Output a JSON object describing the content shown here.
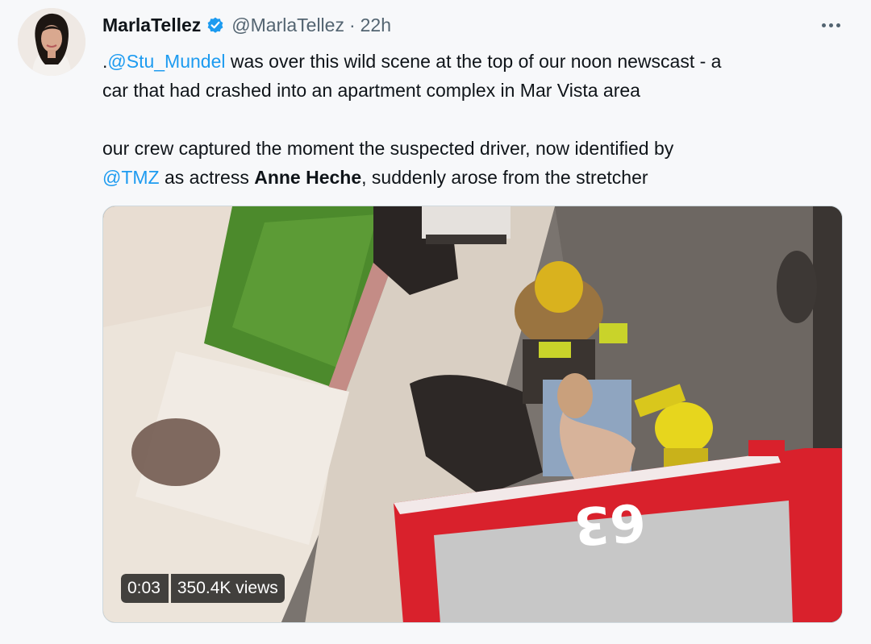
{
  "author": {
    "display_name": "MarlaTellez",
    "handle": "@MarlaTellez",
    "separator": "·",
    "time": "22h",
    "verified": true
  },
  "icons": {
    "verified": "verified-badge-icon",
    "more": "more-options-icon"
  },
  "tweet": {
    "line1_prefix": ".",
    "line1_mention": "@Stu_Mundel",
    "line1_rest": " was over this wild scene at the top of our noon newscast - a",
    "line2": "car that had crashed into an apartment complex in Mar Vista area",
    "line3": "our crew captured the moment the suspected driver, now identified by",
    "line4_mention": "@TMZ",
    "line4_mid": " as actress ",
    "line4_bold": "Anne Heche",
    "line4_end": ", suddenly arose from the stretcher"
  },
  "media": {
    "type": "video",
    "duration": "0:03",
    "views": "350.4K views",
    "truck_number": "63"
  },
  "colors": {
    "link": "#1d9bf0",
    "verified": "#1d9bf0",
    "secondary_text": "#536471",
    "truck_red": "#d9212c"
  }
}
